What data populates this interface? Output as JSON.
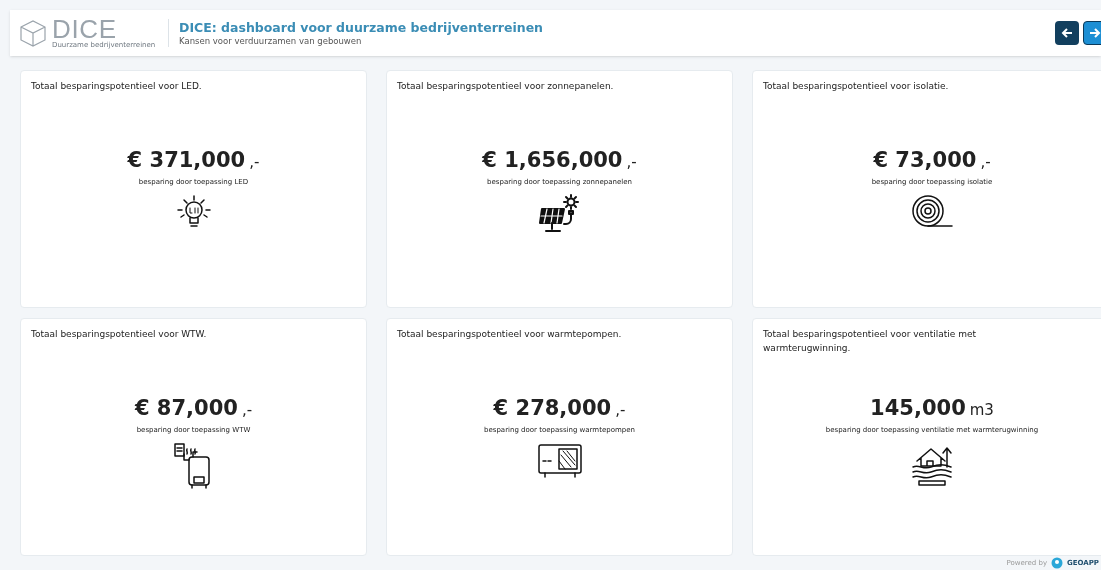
{
  "header": {
    "logo_text": "DICE",
    "logo_subtitle": "Duurzame bedrijventerreinen",
    "title": "DICE: dashboard voor duurzame bedrijventerreinen",
    "subtitle": "Kansen voor verduurzamen van gebouwen",
    "nav_buttons": [
      {
        "kind": "back"
      },
      {
        "kind": "forward"
      }
    ]
  },
  "cards": [
    {
      "title": "Totaal besparingspotentieel voor LED.",
      "value": "€ 371,000",
      "suffix": ",-",
      "caption": "besparing door toepassing LED",
      "kind": "led"
    },
    {
      "title": "Totaal besparingspotentieel voor zonnepanelen.",
      "value": "€ 1,656,000",
      "suffix": ",-",
      "caption": "besparing door toepassing zonnepanelen",
      "kind": "solar"
    },
    {
      "title": "Totaal besparingspotentieel voor isolatie.",
      "value": "€ 73,000",
      "suffix": ",-",
      "caption": "besparing door toepassing isolatie",
      "kind": "insulation"
    },
    {
      "title": "Totaal besparingspotentieel voor WTW.",
      "value": "€ 87,000",
      "suffix": ",-",
      "caption": "besparing door toepassing WTW",
      "kind": "boiler"
    },
    {
      "title": "Totaal besparingspotentieel voor warmtepompen.",
      "value": "€ 278,000",
      "suffix": ",-",
      "caption": "besparing door toepassing warmtepompen",
      "kind": "heatpump"
    },
    {
      "title": "Totaal besparingspotentieel voor ventilatie met warmterugwinning.",
      "value": "145,000",
      "suffix": "m3",
      "caption": "besparing door toepassing ventilatie met warmterugwinning",
      "kind": "house"
    }
  ],
  "footer": {
    "powered_by": "Powered by",
    "brand": "GEOAPP"
  }
}
